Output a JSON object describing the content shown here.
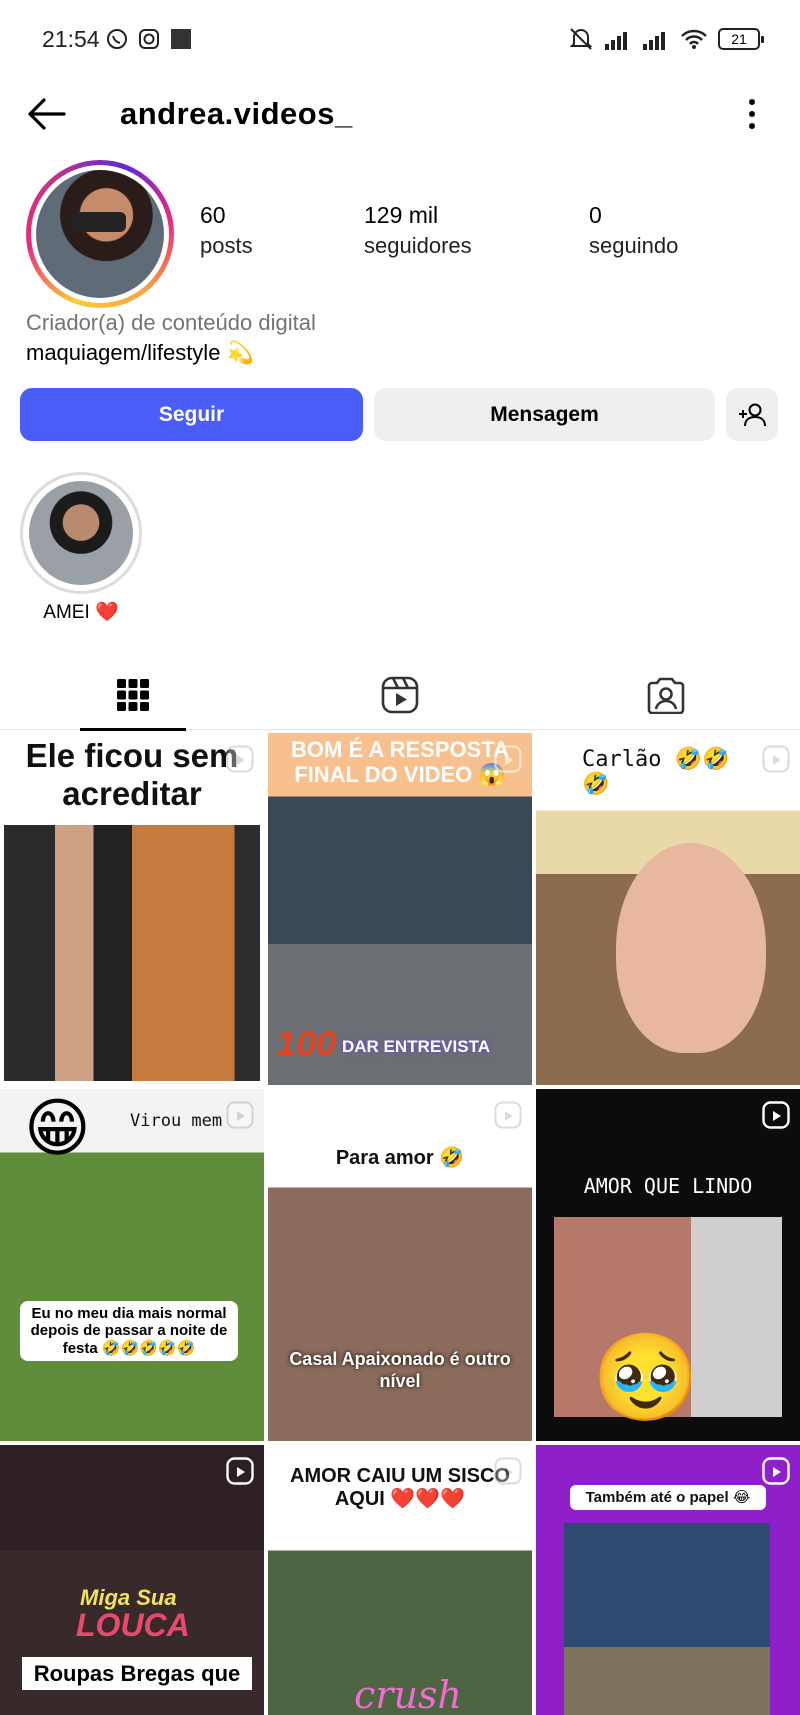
{
  "status_bar": {
    "time": "21:54",
    "battery": "21",
    "icons": [
      "whatsapp-icon",
      "instagram-icon",
      "square-icon",
      "mute-icon",
      "signal-icon",
      "signal-icon",
      "wifi-icon",
      "battery-icon"
    ]
  },
  "header": {
    "username": "andrea.videos_",
    "back_icon": "arrow-left-icon",
    "more_icon": "more-vertical-icon"
  },
  "profile": {
    "stats": [
      {
        "value": "60",
        "label": "posts"
      },
      {
        "value": "129 mil",
        "label": "seguidores"
      },
      {
        "value": "0",
        "label": "seguindo"
      }
    ],
    "category": "Criador(a) de conteúdo digital",
    "bio": "maquiagem/lifestyle 💫"
  },
  "actions": {
    "follow": "Seguir",
    "message": "Mensagem",
    "add_icon": "add-person-icon"
  },
  "highlights": [
    {
      "label": "AMEI ❤️"
    }
  ],
  "tabs": [
    {
      "name": "grid",
      "icon": "grid-icon",
      "active": true
    },
    {
      "name": "reels",
      "icon": "reels-icon",
      "active": false
    },
    {
      "name": "tagged",
      "icon": "tagged-icon",
      "active": false
    }
  ],
  "posts": [
    {
      "caption": "Ele ficou sem acreditar"
    },
    {
      "caption": "BOM É A RESPOSTA FINAL DO VIDEO 😱",
      "badge": "100",
      "extra": "DAR ENTREVISTA"
    },
    {
      "caption": "Carlão 🤣🤣🤣"
    },
    {
      "caption": "Eu no meu dia mais normal depois de  passar a noite de festa 🤣🤣🤣🤣🤣",
      "top": "Virou mem"
    },
    {
      "caption": "Para amor 🤣",
      "extra": "Casal Apaixonado é outro nível"
    },
    {
      "caption": "AMOR QUE LINDO"
    },
    {
      "caption": "Roupas Bregas que",
      "logo1": "Miga Sua",
      "logo2": "LOUCA"
    },
    {
      "caption": "AMOR CAIU UM SISCO AQUI ❤️❤️❤️",
      "extra": "crush"
    },
    {
      "caption": "Também até o papel 😂"
    }
  ],
  "colors": {
    "follow_button": "#4a5df9",
    "secondary_button": "#efeff2"
  }
}
